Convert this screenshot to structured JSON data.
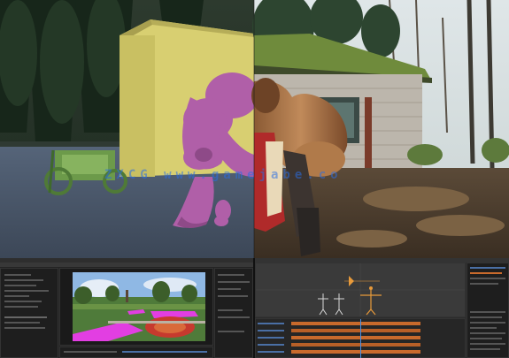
{
  "watermark": {
    "text": "ZXCG www.gamejabe.co"
  },
  "colors": {
    "accent_blue": "#2b6ee6",
    "magenta_mask": "#e23ee2",
    "orange_keys": "#c86a2c",
    "render_wall": "#d8cf71",
    "render_ground": "#4a5668",
    "character_pink": "#b05fa8"
  },
  "panels": {
    "after_effects": {
      "icon": "window-icon"
    },
    "blender": {
      "icon": "armature-icon"
    }
  }
}
